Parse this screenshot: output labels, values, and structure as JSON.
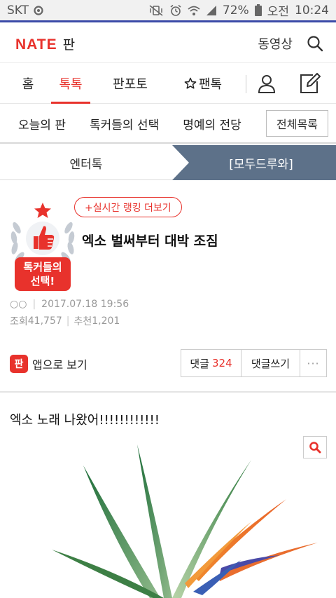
{
  "status": {
    "carrier": "SKT",
    "battery": "72%",
    "ampm": "오전",
    "time": "10:24"
  },
  "header": {
    "logo_brand": "NATE",
    "logo_section": "판",
    "video_link": "동영상"
  },
  "main_nav": {
    "tabs": [
      {
        "label": "홈"
      },
      {
        "label": "톡톡"
      },
      {
        "label": "판포토"
      },
      {
        "label": "팬톡"
      }
    ]
  },
  "sub_nav": {
    "items": [
      {
        "label": "오늘의 판"
      },
      {
        "label": "톡커들의 선택"
      },
      {
        "label": "명예의 전당"
      }
    ],
    "all_list": "전체목록"
  },
  "category": {
    "left": "엔터톡",
    "right": "[모두드루와]"
  },
  "article": {
    "badge_text_line1": "톡커들의",
    "badge_text_line2": "선택!",
    "ranking_button": "+실시간 랭킹 더보기",
    "title": "엑소 벌써부터 대박 조짐",
    "author": "○○",
    "date": "2017.07.18 19:56",
    "views_label": "조회",
    "views": "41,757",
    "recommend_label": "추천",
    "recommend": "1,201"
  },
  "actions": {
    "app_icon_text": "판",
    "app_view": "앱으로 보기",
    "comments_label": "댓글",
    "comments_count": "324",
    "write_comment": "댓글쓰기",
    "more": "···"
  },
  "content": {
    "body_text": "엑소 노래 나왔어!!!!!!!!!!!!"
  },
  "colors": {
    "brand_red": "#e8322c",
    "category_active_bg": "#5d7189",
    "status_underline": "#3b4aa8"
  }
}
